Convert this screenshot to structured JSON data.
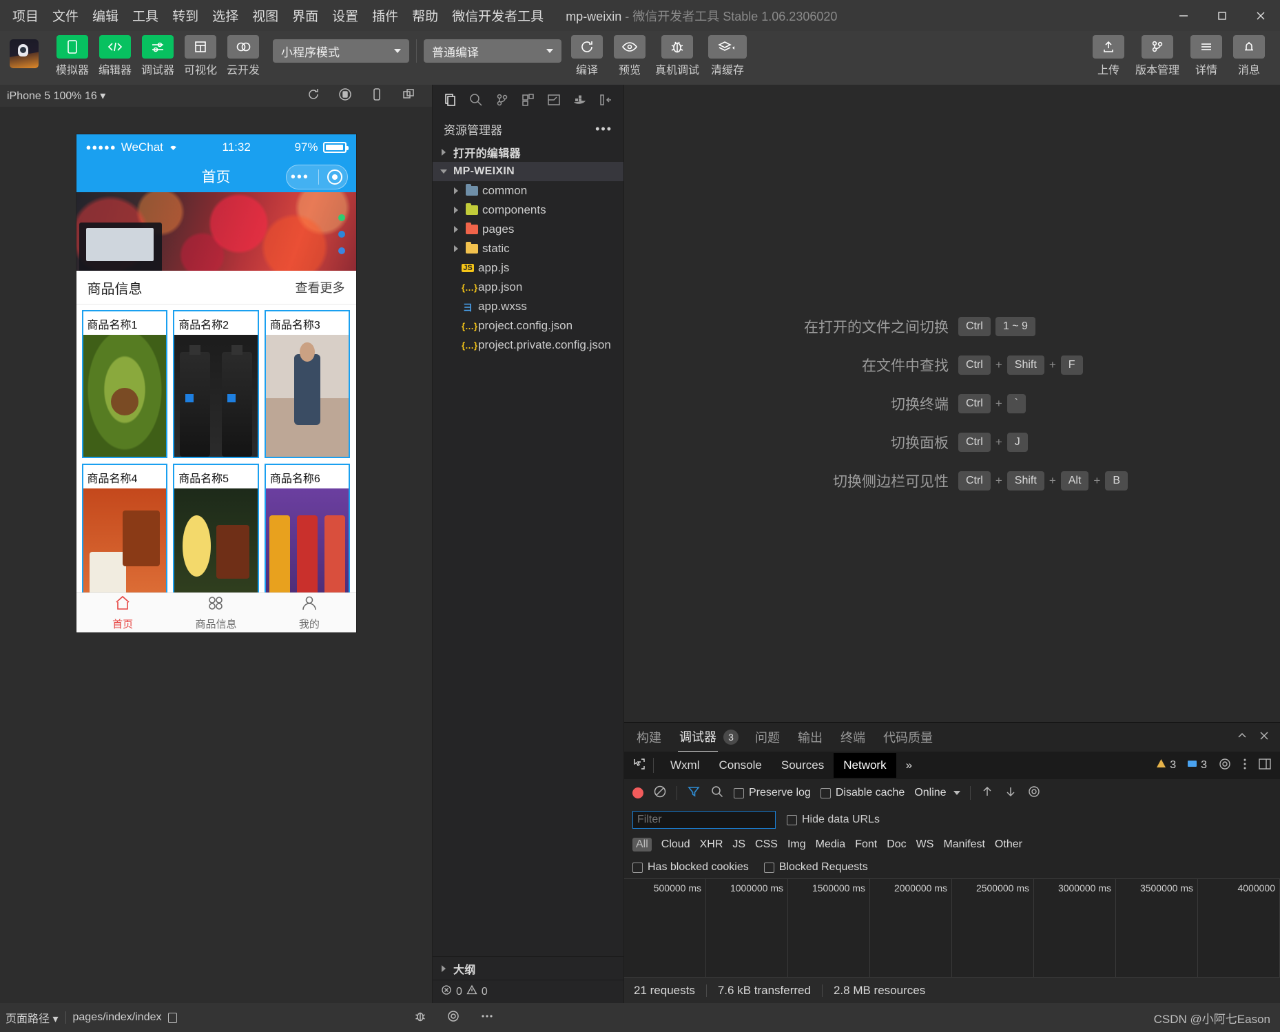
{
  "titlebar": {
    "menus": [
      "项目",
      "文件",
      "编辑",
      "工具",
      "转到",
      "选择",
      "视图",
      "界面",
      "设置",
      "插件",
      "帮助",
      "微信开发者工具"
    ],
    "project_name": "mp-weixin",
    "app_subtitle": "- 微信开发者工具 Stable 1.06.2306020"
  },
  "toolbar": {
    "left_items": [
      {
        "label": "模拟器",
        "icon": "phone-icon",
        "style": "green"
      },
      {
        "label": "编辑器",
        "icon": "code-icon",
        "style": "green"
      },
      {
        "label": "调试器",
        "icon": "debug-toggle-icon",
        "style": "green"
      },
      {
        "label": "可视化",
        "icon": "layout-icon",
        "style": "grey"
      },
      {
        "label": "云开发",
        "icon": "cloud-icon",
        "style": "grey"
      }
    ],
    "mode_select": "小程序模式",
    "compile_select": "普通编译",
    "mid_items": [
      {
        "label": "编译",
        "icon": "refresh-icon"
      },
      {
        "label": "预览",
        "icon": "eye-icon"
      },
      {
        "label": "真机调试",
        "icon": "bug-icon"
      },
      {
        "label": "清缓存",
        "icon": "layers-icon"
      }
    ],
    "right_items": [
      {
        "label": "上传",
        "icon": "upload-icon"
      },
      {
        "label": "版本管理",
        "icon": "branch-icon"
      },
      {
        "label": "详情",
        "icon": "menu-icon"
      },
      {
        "label": "消息",
        "icon": "bell-icon"
      }
    ]
  },
  "simulator": {
    "device_label": "iPhone 5 100% 16",
    "toolbar_icons": [
      "rotate-icon",
      "record-icon",
      "device-icon",
      "multiwindow-icon"
    ],
    "phone": {
      "carrier": "WeChat",
      "signal_dots": "●●●●●",
      "time": "11:32",
      "battery_percent": "97%",
      "page_title": "首页",
      "section_title": "商品信息",
      "section_more": "查看更多",
      "products": [
        {
          "name": "商品名称1",
          "image": "avocado"
        },
        {
          "name": "商品名称2",
          "image": "bottles"
        },
        {
          "name": "商品名称3",
          "image": "model"
        },
        {
          "name": "商品名称4",
          "image": "rice"
        },
        {
          "name": "商品名称5",
          "image": "bento"
        },
        {
          "name": "商品名称6",
          "image": "drinks"
        }
      ],
      "tabs": [
        {
          "label": "首页",
          "icon": "home-icon",
          "active": true
        },
        {
          "label": "商品信息",
          "icon": "grid-icon",
          "active": false
        },
        {
          "label": "我的",
          "icon": "user-icon",
          "active": false
        }
      ]
    }
  },
  "explorer": {
    "icons": [
      "files-icon",
      "search-icon",
      "source-control-icon",
      "extensions-icon",
      "layout-icon",
      "docker-icon",
      "collapse-icon"
    ],
    "title": "资源管理器",
    "more": "•••",
    "sections": [
      {
        "label": "打开的编辑器",
        "expanded": false
      },
      {
        "label": "MP-WEIXIN",
        "expanded": true
      }
    ],
    "folders": [
      {
        "name": "common",
        "color": "#6f8fa8",
        "kind": "plain"
      },
      {
        "name": "components",
        "color": "#c2cc3a",
        "kind": "components"
      },
      {
        "name": "pages",
        "color": "#f0644a",
        "kind": "pages"
      },
      {
        "name": "static",
        "color": "#f2c14e",
        "kind": "static"
      }
    ],
    "files": [
      {
        "name": "app.js",
        "icon": "JS",
        "color": "#f5c518"
      },
      {
        "name": "app.json",
        "icon": "{…}",
        "color": "#f5c518"
      },
      {
        "name": "app.wxss",
        "icon": "彐",
        "color": "#4aa3f0"
      },
      {
        "name": "project.config.json",
        "icon": "{…}",
        "color": "#f5c518"
      },
      {
        "name": "project.private.config.json",
        "icon": "{…}",
        "color": "#f5c518"
      }
    ],
    "outline_label": "大纲",
    "problems": {
      "errors": "0",
      "warnings": "0"
    }
  },
  "editor": {
    "shortcuts": [
      {
        "label": "在打开的文件之间切换",
        "keys": [
          "Ctrl",
          "1 ~ 9"
        ],
        "separators": []
      },
      {
        "label": "在文件中查找",
        "keys": [
          "Ctrl",
          "Shift",
          "F"
        ],
        "separators": [
          "+",
          "+"
        ]
      },
      {
        "label": "切换终端",
        "keys": [
          "Ctrl",
          "`"
        ],
        "separators": [
          "+"
        ]
      },
      {
        "label": "切换面板",
        "keys": [
          "Ctrl",
          "J"
        ],
        "separators": [
          "+"
        ]
      },
      {
        "label": "切换侧边栏可见性",
        "keys": [
          "Ctrl",
          "Shift",
          "Alt",
          "B"
        ],
        "separators": [
          "+",
          "+",
          "+"
        ]
      }
    ]
  },
  "devtools": {
    "tabs": [
      {
        "label": "构建",
        "active": false,
        "badge": null
      },
      {
        "label": "调试器",
        "active": true,
        "badge": "3"
      },
      {
        "label": "问题",
        "active": false,
        "badge": null
      },
      {
        "label": "输出",
        "active": false,
        "badge": null
      },
      {
        "label": "终端",
        "active": false,
        "badge": null
      },
      {
        "label": "代码质量",
        "active": false,
        "badge": null
      }
    ],
    "panel_icons": [
      "collapse-up-icon",
      "close-icon"
    ],
    "subtabs": [
      {
        "label": "Wxml",
        "active": false
      },
      {
        "label": "Console",
        "active": false
      },
      {
        "label": "Sources",
        "active": false
      },
      {
        "label": "Network",
        "active": true
      },
      {
        "label": "»",
        "active": false
      }
    ],
    "warn_count": "3",
    "info_count": "3",
    "network": {
      "preserve_log": "Preserve log",
      "disable_cache": "Disable cache",
      "throttle": "Online",
      "filter_placeholder": "Filter",
      "hide_data_urls": "Hide data URLs",
      "types": [
        "All",
        "Cloud",
        "XHR",
        "JS",
        "CSS",
        "Img",
        "Media",
        "Font",
        "Doc",
        "WS",
        "Manifest",
        "Other"
      ],
      "active_type": "All",
      "has_blocked_cookies": "Has blocked cookies",
      "blocked_requests": "Blocked Requests",
      "timeline_ticks": [
        "500000 ms",
        "1000000 ms",
        "1500000 ms",
        "2000000 ms",
        "2500000 ms",
        "3000000 ms",
        "3500000 ms",
        "4000000"
      ],
      "summary": [
        "21 requests",
        "7.6 kB transferred",
        "2.8 MB resources"
      ]
    }
  },
  "statusbar": {
    "page_path_label": "页面路径",
    "page_path_value": "pages/index/index",
    "icons": [
      "bug-icon",
      "eye-target-icon",
      "more-icon"
    ],
    "watermark": "CSDN @小阿七Eason"
  }
}
